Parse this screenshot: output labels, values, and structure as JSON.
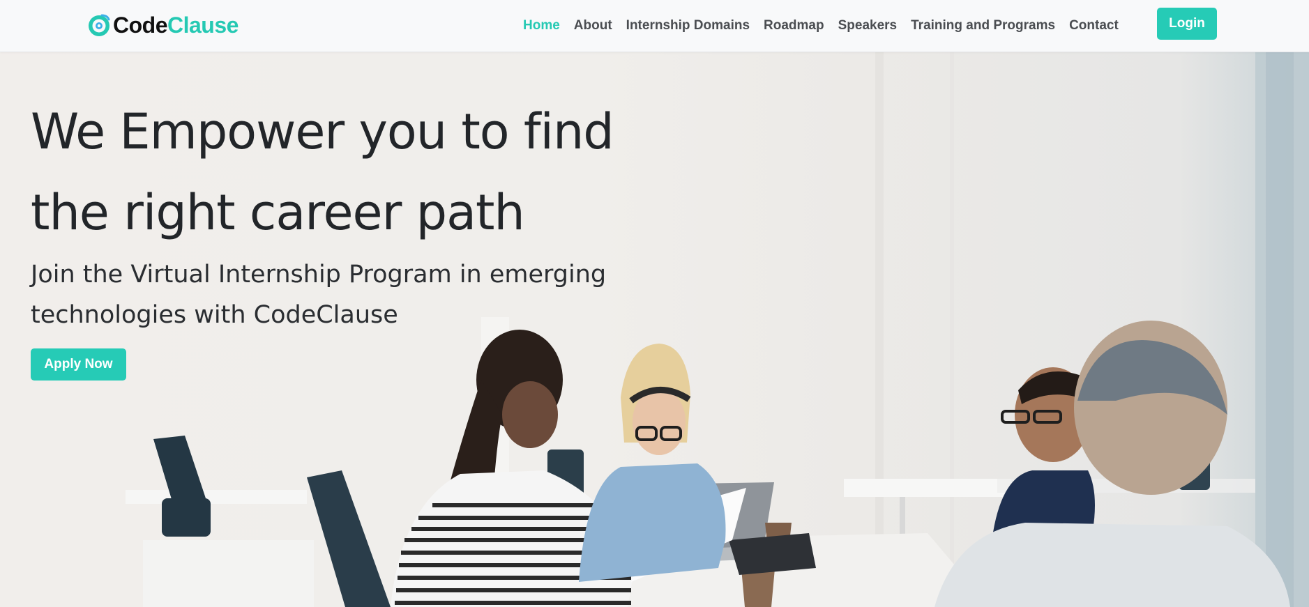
{
  "brand": {
    "name_part1": "Code",
    "name_part2": "Clause",
    "logo_icon": "codeclause-swirl-logo"
  },
  "nav": {
    "items": [
      {
        "label": "Home",
        "active": true
      },
      {
        "label": "About"
      },
      {
        "label": "Internship Domains"
      },
      {
        "label": "Roadmap"
      },
      {
        "label": "Speakers"
      },
      {
        "label": "Training and Programs"
      },
      {
        "label": "Contact"
      }
    ],
    "login_label": "Login"
  },
  "hero": {
    "headline_line1": "We Empower you to find",
    "headline_line2": "the right career path",
    "subline_line1": "Join the Virtual Internship Program in emerging",
    "subline_line2": "technologies with CodeClause",
    "apply_label": "Apply Now"
  },
  "colors": {
    "accent": "#26cbb6",
    "text_dark": "#222529",
    "nav_text": "#4a4d51"
  }
}
